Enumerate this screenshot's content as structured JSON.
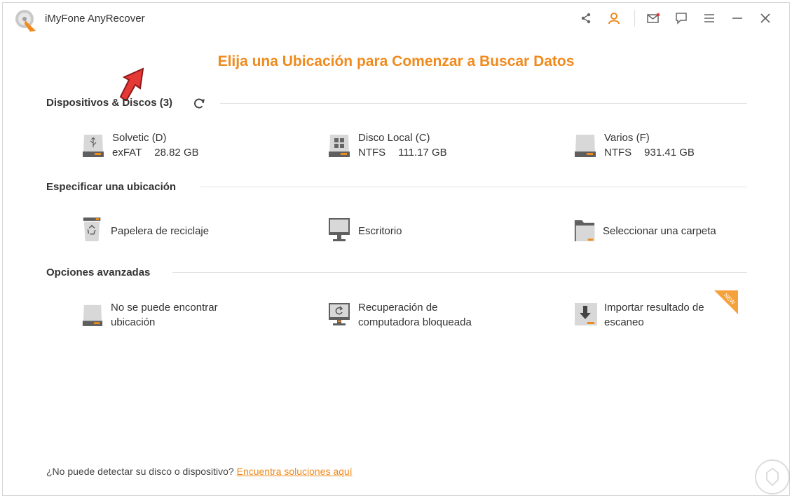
{
  "window": {
    "title": "iMyFone AnyRecover"
  },
  "toolbar": {
    "icons": [
      "share-icon",
      "account-icon",
      "mail-icon",
      "feedback-icon",
      "menu-icon",
      "minimize-icon",
      "close-icon"
    ]
  },
  "colors": {
    "accent": "#f08a1c",
    "annotation_arrow": "#e53935"
  },
  "main": {
    "heading": "Elija una Ubicación para Comenzar a Buscar Datos",
    "devices_section": {
      "title": "Dispositivos & Discos (3)",
      "items": [
        {
          "name": "Solvetic (D)",
          "fs": "exFAT",
          "size": "28.82 GB",
          "icon": "usb-drive-icon"
        },
        {
          "name": "Disco Local (C)",
          "fs": "NTFS",
          "size": "111.17 GB",
          "icon": "windows-drive-icon"
        },
        {
          "name": "Varios (F)",
          "fs": "NTFS",
          "size": "931.41 GB",
          "icon": "hard-drive-icon"
        }
      ]
    },
    "location_section": {
      "title": "Especificar una ubicación",
      "items": [
        {
          "label": "Papelera de reciclaje",
          "icon": "recycle-bin-icon"
        },
        {
          "label": "Escritorio",
          "icon": "desktop-icon"
        },
        {
          "label": "Seleccionar una carpeta",
          "icon": "folder-icon"
        }
      ]
    },
    "advanced_section": {
      "title": "Opciones avanzadas",
      "items": [
        {
          "line1": "No se puede encontrar",
          "line2": "ubicación",
          "icon": "lost-drive-icon"
        },
        {
          "line1": "Recuperación de",
          "line2": "computadora bloqueada",
          "icon": "crashed-computer-icon"
        },
        {
          "line1": "Importar resultado de",
          "line2": "escaneo",
          "icon": "import-icon",
          "badge": "NEW"
        }
      ]
    }
  },
  "footer": {
    "question": "¿No puede detectar su disco o dispositivo?",
    "link": "Encuentra soluciones aquí"
  }
}
